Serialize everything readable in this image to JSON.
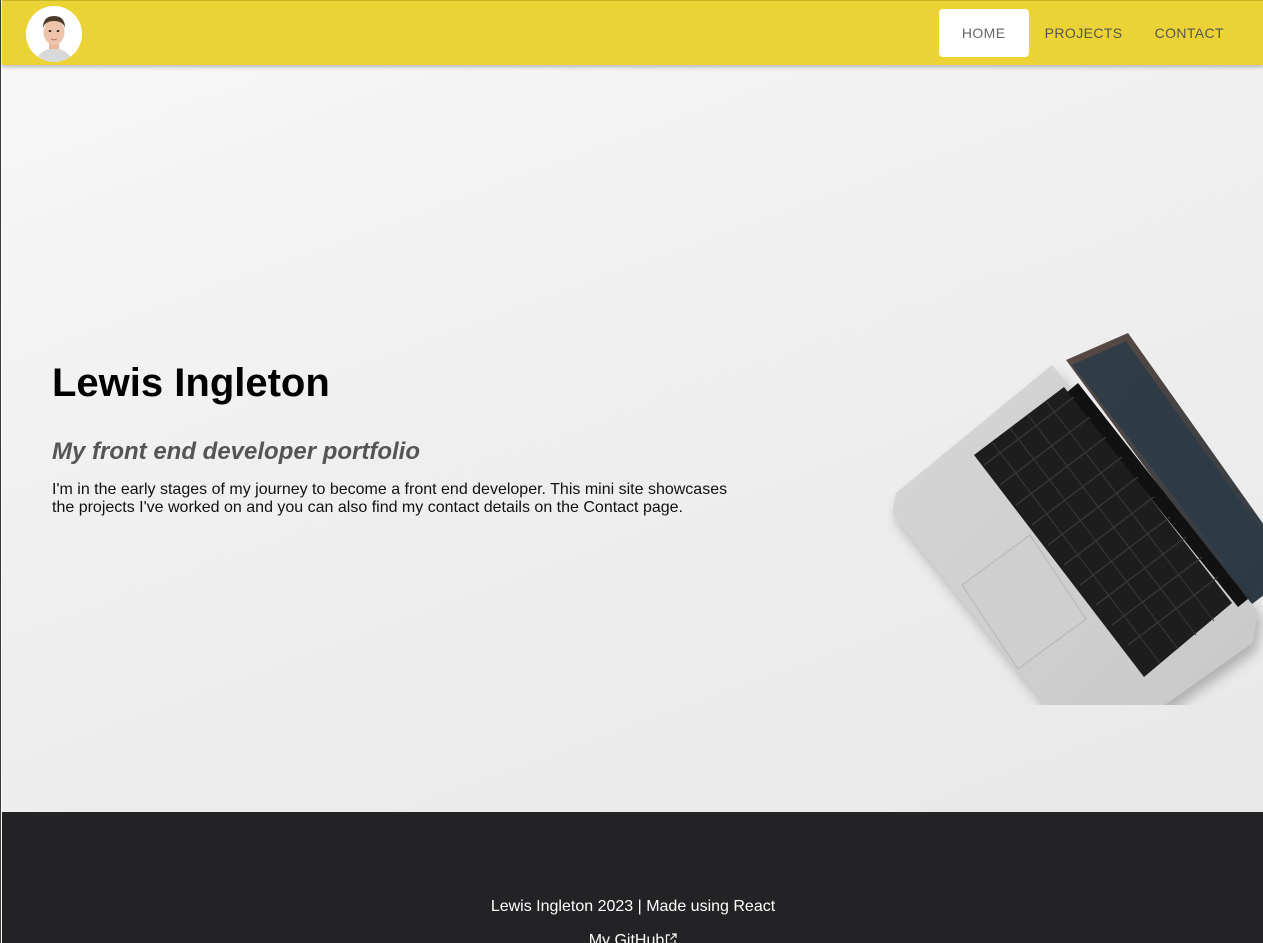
{
  "colors": {
    "navbar_background": "#ebd336",
    "footer_background": "#232325",
    "hero_background": "#efefef"
  },
  "navbar": {
    "avatar_icon": "profile-photo",
    "links": [
      {
        "label": "HOME",
        "active": true
      },
      {
        "label": "PROJECTS",
        "active": false
      },
      {
        "label": "CONTACT",
        "active": false
      }
    ]
  },
  "hero": {
    "title": "Lewis Ingleton",
    "subtitle": "My front end developer portfolio",
    "description": "I'm in the early stages of my journey to become a front end developer. This mini site showcases the projects I've worked on and you can also find my contact details on the Contact page.",
    "image_icon": "laptop-image"
  },
  "footer": {
    "credit": "Lewis Ingleton 2023 | Made using React",
    "github_link": "My GitHub",
    "github_icon": "external-link-icon"
  }
}
